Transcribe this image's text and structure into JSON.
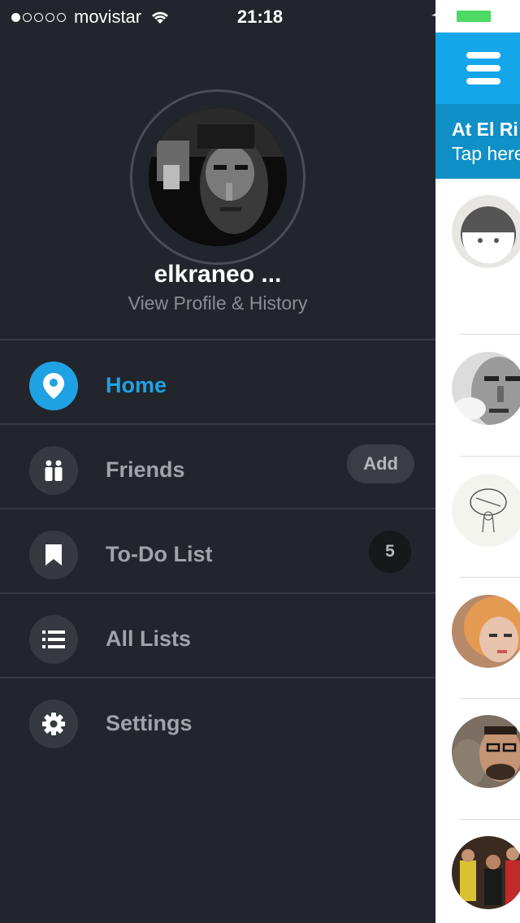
{
  "status_bar": {
    "carrier": "movistar",
    "time": "21:18",
    "signal_dots_filled": 1,
    "signal_dots_total": 5,
    "battery_color": "#4cd964"
  },
  "profile": {
    "name": "elkraneo ...",
    "link": "View Profile & History"
  },
  "menu": {
    "items": [
      {
        "label": "Home",
        "icon": "location-pin-icon",
        "active": true
      },
      {
        "label": "Friends",
        "icon": "friends-icon",
        "action": "Add"
      },
      {
        "label": "To-Do List",
        "icon": "bookmark-icon",
        "count": "5"
      },
      {
        "label": "All Lists",
        "icon": "list-icon"
      },
      {
        "label": "Settings",
        "icon": "gear-icon"
      }
    ]
  },
  "main": {
    "banner_title": "At El Ri",
    "banner_subtitle": "Tap here"
  },
  "colors": {
    "accent": "#1fa2e3",
    "drawer_bg": "#22252b",
    "topbar": "#14a6e9"
  }
}
